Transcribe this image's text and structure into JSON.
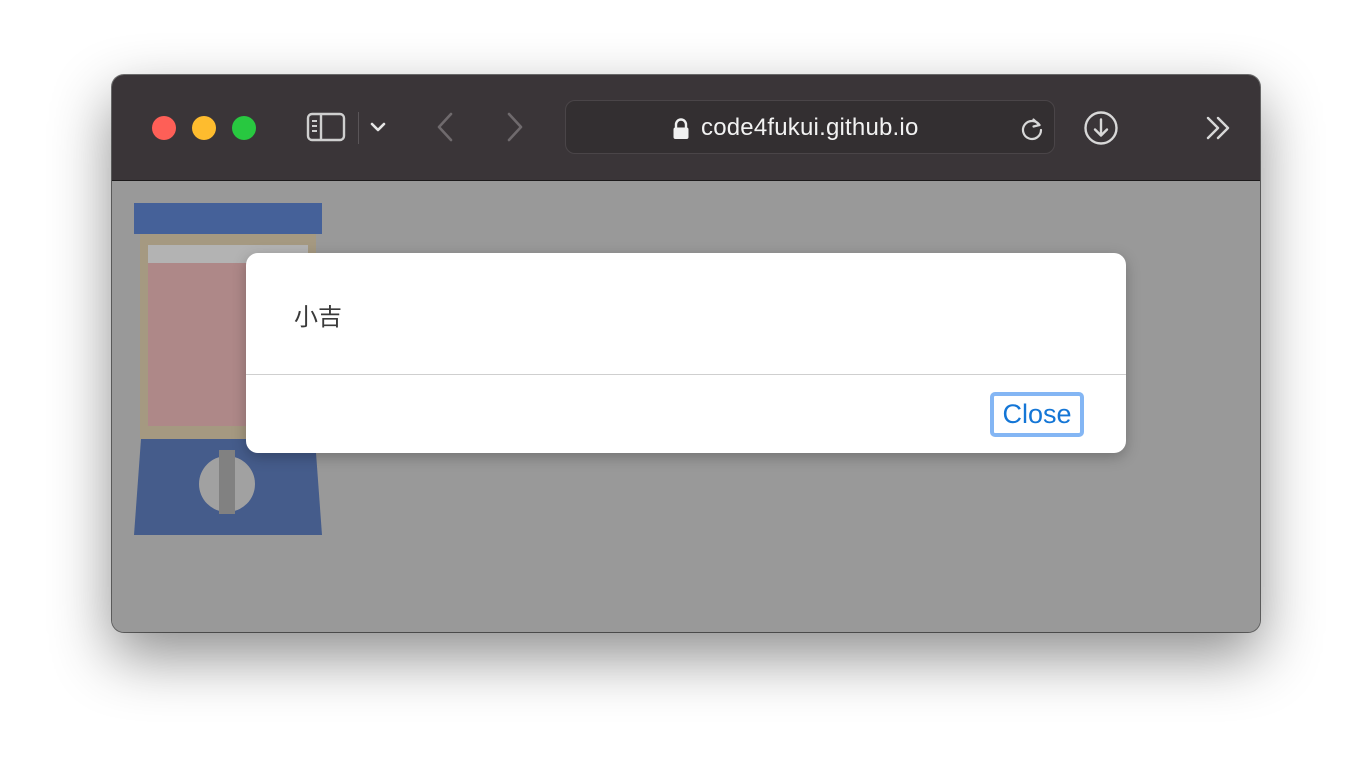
{
  "browser": {
    "url": "code4fukui.github.io",
    "icons": {
      "sidebar": "sidebar-icon",
      "tab_menu": "chevron-down-icon",
      "back": "chevron-left-icon",
      "forward": "chevron-right-icon",
      "lock": "lock-icon",
      "reload": "reload-icon",
      "download": "download-icon",
      "overflow": "double-chevron-right-icon"
    }
  },
  "dialog": {
    "message": "小吉",
    "close_label": "Close"
  },
  "colors": {
    "toolbar_bg": "#3a3538",
    "page_dim": "#9a9a9a",
    "gacha_top": "#003399",
    "gacha_base": "#002266",
    "button_text": "#1476d6",
    "button_focus_ring": "#84b6f4"
  }
}
